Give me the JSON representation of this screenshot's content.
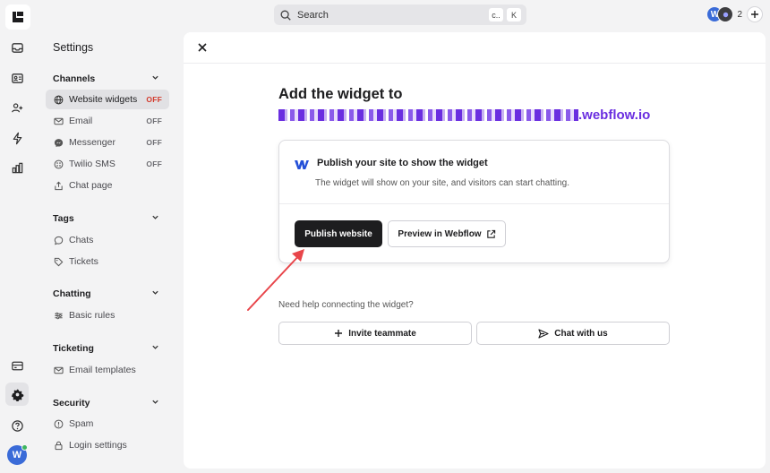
{
  "search": {
    "placeholder": "Search",
    "shortcut_1": "c..",
    "shortcut_2": "K"
  },
  "header": {
    "avatar_initial": "W",
    "member_count": "2"
  },
  "user": {
    "initial": "W"
  },
  "settings": {
    "title": "Settings",
    "groups": [
      {
        "title": "Channels",
        "items": [
          {
            "label": "Website widgets",
            "status": "OFF",
            "icon": "globe-icon",
            "active": true
          },
          {
            "label": "Email",
            "status": "OFF",
            "icon": "mail-icon"
          },
          {
            "label": "Messenger",
            "status": "OFF",
            "icon": "messenger-icon"
          },
          {
            "label": "Twilio SMS",
            "status": "OFF",
            "icon": "twilio-icon"
          },
          {
            "label": "Chat page",
            "status": "",
            "icon": "share-icon"
          }
        ]
      },
      {
        "title": "Tags",
        "items": [
          {
            "label": "Chats",
            "icon": "chat-bubble-icon"
          },
          {
            "label": "Tickets",
            "icon": "tag-icon"
          }
        ]
      },
      {
        "title": "Chatting",
        "items": [
          {
            "label": "Basic rules",
            "icon": "sliders-icon"
          }
        ]
      },
      {
        "title": "Ticketing",
        "items": [
          {
            "label": "Email templates",
            "icon": "mail-icon"
          }
        ]
      },
      {
        "title": "Security",
        "items": [
          {
            "label": "Spam",
            "icon": "alert-circle-icon"
          },
          {
            "label": "Login settings",
            "icon": "lock-icon"
          }
        ]
      }
    ]
  },
  "main": {
    "title": "Add the widget to",
    "domain_suffix": ".webflow.io",
    "card": {
      "title": "Publish your site to show the widget",
      "subtitle": "The widget will show on your site, and visitors can start chatting.",
      "publish_button": "Publish website",
      "preview_button": "Preview in Webflow"
    },
    "help": {
      "text": "Need help connecting the widget?",
      "invite_button": "Invite teammate",
      "chat_button": "Chat with us"
    }
  },
  "colors": {
    "accent": "#6a2ee0",
    "off_active": "#d33a2c",
    "arrow": "#e8454a"
  }
}
